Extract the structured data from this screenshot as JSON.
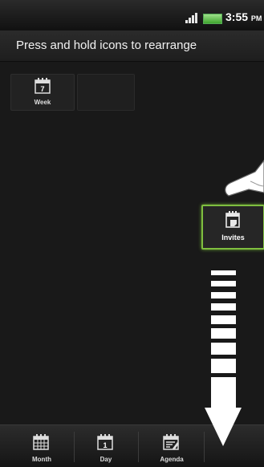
{
  "status_bar": {
    "time": "3:55",
    "ampm": "PM"
  },
  "header": {
    "title": "Press and hold icons to rearrange"
  },
  "tiles": {
    "week": {
      "label": "Week",
      "icon": "calendar-week-icon",
      "number": "7"
    },
    "invites": {
      "label": "Invites",
      "icon": "calendar-invites-icon"
    }
  },
  "bottom_tabs": [
    {
      "label": "Month",
      "icon": "calendar-month-icon"
    },
    {
      "label": "Day",
      "icon": "calendar-day-icon",
      "number": "1"
    },
    {
      "label": "Agenda",
      "icon": "calendar-agenda-icon"
    }
  ],
  "colors": {
    "selection": "#7fbf3f",
    "background": "#1a1a1a"
  }
}
